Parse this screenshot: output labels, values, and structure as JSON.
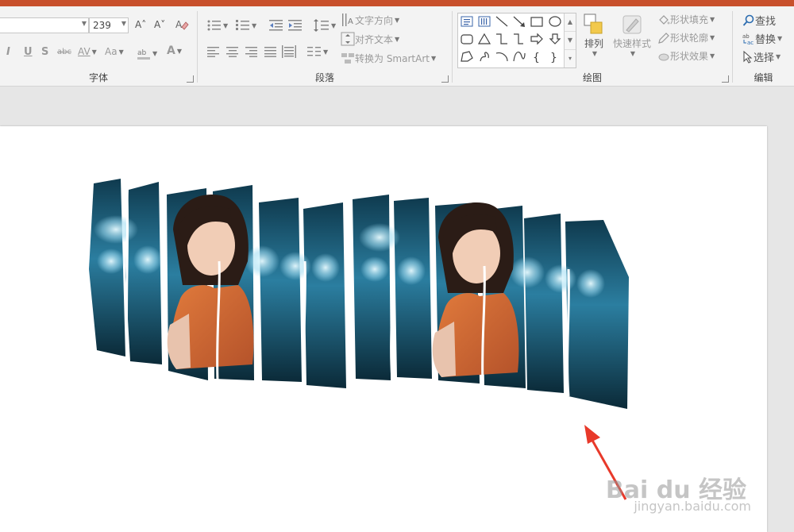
{
  "ribbon": {
    "font_group": {
      "label": "字体",
      "font_name_value": "",
      "font_size_value": "239",
      "grow_font_glyph": "A˄",
      "shrink_font_glyph": "A˅",
      "italic_glyph": "I",
      "underline_glyph": "U",
      "shadow_glyph": "S",
      "strike_glyph": "abc",
      "spacing_glyph": "AV",
      "case_glyph": "Aa",
      "font_color_glyph": "A"
    },
    "paragraph_group": {
      "label": "段落",
      "text_direction": "文字方向",
      "align_text": "对齐文本",
      "convert_smartart": "转换为 SmartArt"
    },
    "drawing_group": {
      "label": "绘图",
      "arrange": "排列",
      "quick_styles": "快速样式",
      "shape_fill": "形状填充",
      "shape_outline": "形状轮廓",
      "shape_effects": "形状效果"
    },
    "editing_group": {
      "label": "编辑",
      "find": "查找",
      "replace": "替换",
      "select": "选择"
    }
  },
  "watermark": {
    "brand": "Bai du 经验",
    "url": "jingyan.baidu.com"
  },
  "colors": {
    "title_bar": "#c8502c",
    "ribbon_bg": "#f3f3f3",
    "workspace_bg": "#e6e6e6",
    "slide_bg": "#ffffff",
    "annotation_arrow": "#e8392a",
    "accent_blue": "#2b6cb0"
  }
}
